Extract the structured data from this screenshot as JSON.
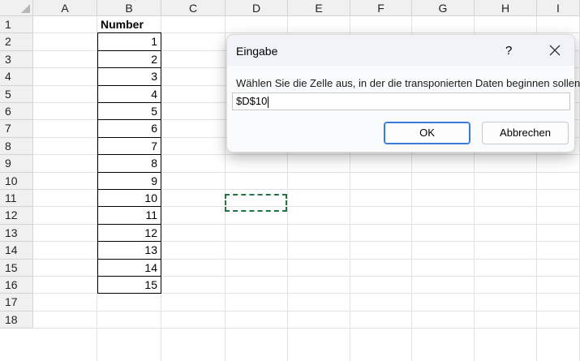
{
  "columns": [
    "A",
    "B",
    "C",
    "D",
    "E",
    "F",
    "G",
    "H",
    "I"
  ],
  "rows": [
    "1",
    "2",
    "3",
    "4",
    "5",
    "6",
    "7",
    "8",
    "9",
    "10",
    "11",
    "12",
    "13",
    "14",
    "15",
    "16",
    "17",
    "18"
  ],
  "column_b": {
    "header": "Number",
    "values": [
      "1",
      "2",
      "3",
      "4",
      "5",
      "6",
      "7",
      "8",
      "9",
      "10",
      "11",
      "12",
      "13",
      "14",
      "15"
    ]
  },
  "dialog": {
    "title": "Eingabe",
    "help_label": "?",
    "prompt": "Wählen Sie die Zelle aus, in der die transponierten Daten beginnen sollen:",
    "input_value": "$D$10",
    "ok_label": "OK",
    "cancel_label": "Abbrechen"
  },
  "colors": {
    "marquee": "#217346",
    "ok_border": "#3a7bd5"
  },
  "icons": {
    "close": "close-icon",
    "corner": "select-all-corner-icon"
  }
}
